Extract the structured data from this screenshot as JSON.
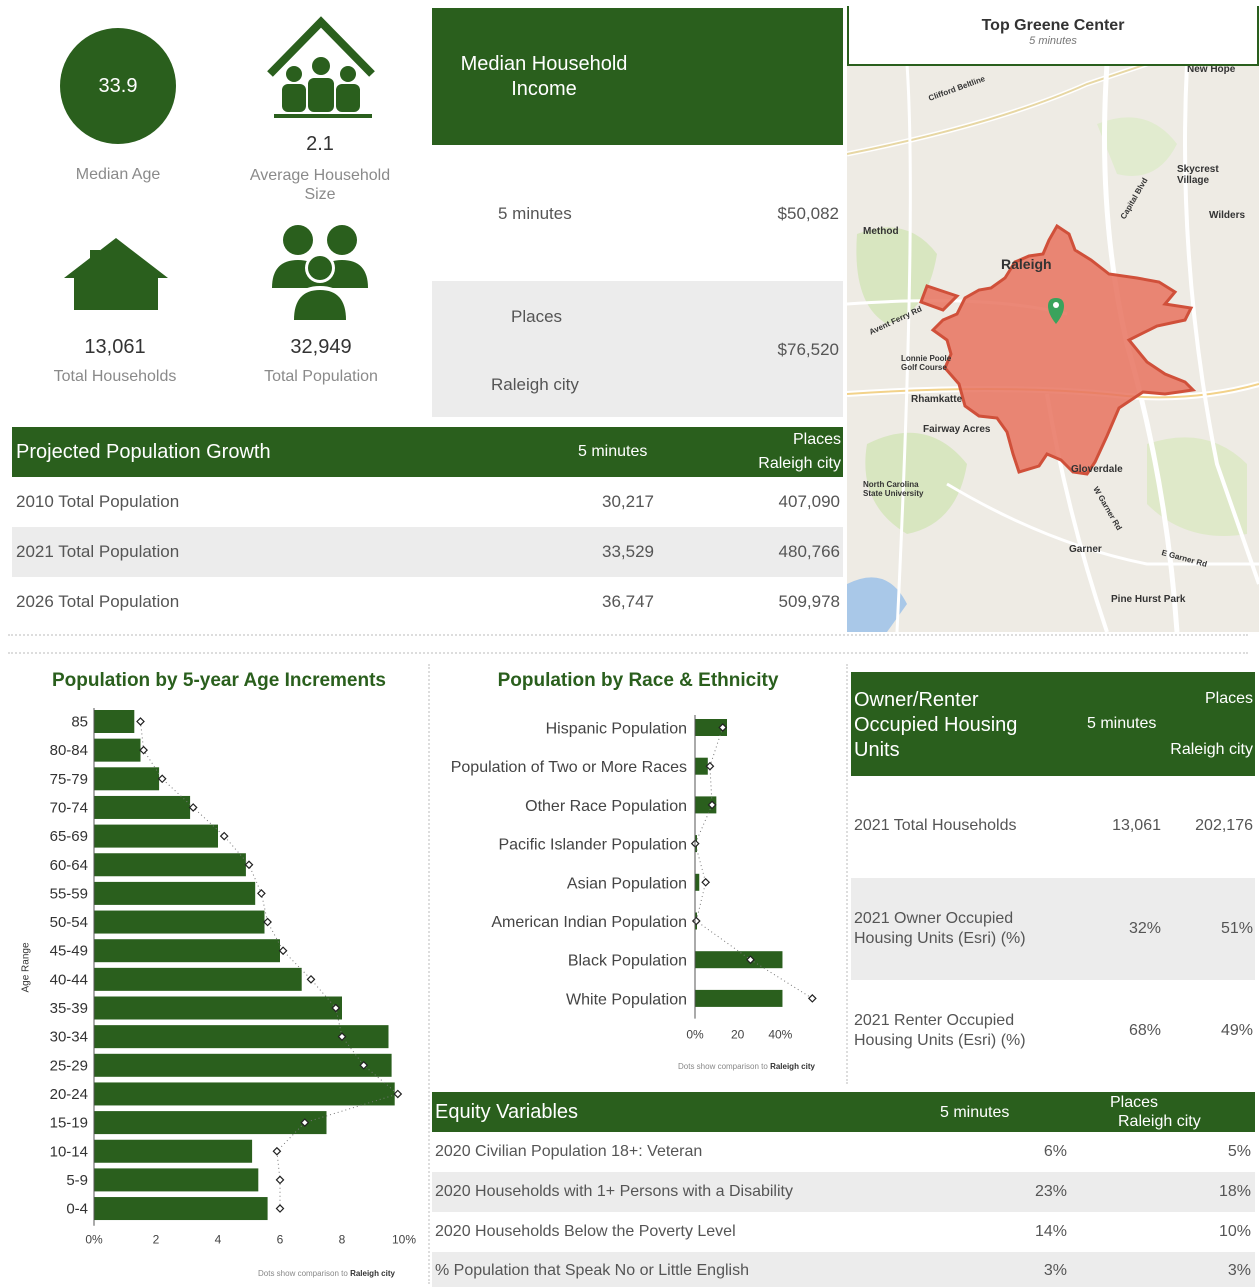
{
  "stats": {
    "median_age_value": "33.9",
    "median_age_label": "Median Age",
    "household_size_value": "2.1",
    "household_size_label": "Average Household Size",
    "total_households_value": "13,061",
    "total_households_label": "Total Households",
    "total_population_value": "32,949",
    "total_population_label": "Total Population"
  },
  "income": {
    "title": "Median Household Income",
    "row1_label": "5 minutes",
    "row1_value": "$50,082",
    "row2_label_a": "Places",
    "row2_label_b": "Raleigh city",
    "row2_value": "$76,520"
  },
  "map": {
    "title": "Top Greene Center",
    "subtitle": "5 minutes",
    "places": [
      "Raleigh",
      "Method",
      "Skycrest Village",
      "Wilders",
      "New Hope",
      "Rhamkatte",
      "Fairway Acres",
      "Lonnie Poole Golf Course",
      "North Carolina State University",
      "Gloverdale",
      "Garner",
      "Pine Hurst Park",
      "Clifford Beltline",
      "E Garner Rd",
      "W Garner Rd",
      "Avent Ferry Rd",
      "Capital Blvd"
    ]
  },
  "growth": {
    "title": "Projected Population Growth",
    "col1": "5 minutes",
    "col2_a": "Places",
    "col2_b": "Raleigh city",
    "rows": [
      {
        "label": "2010 Total Population",
        "v1": "30,217",
        "v2": "407,090"
      },
      {
        "label": "2021 Total Population",
        "v1": "33,529",
        "v2": "480,766"
      },
      {
        "label": "2026 Total Population",
        "v1": "36,747",
        "v2": "509,978"
      }
    ]
  },
  "age_chart": {
    "footnote_prefix": "Dots show comparison to",
    "footnote_place": "Raleigh city"
  },
  "race_chart": {
    "footnote_prefix": "Dots show comparison to",
    "footnote_place": "Raleigh city"
  },
  "chart_data": [
    {
      "type": "bar",
      "title": "Population by 5-year Age Increments",
      "ylabel": "Age Range",
      "xlabel": "",
      "xlim": [
        0,
        10
      ],
      "xticks": [
        "0%",
        "2",
        "4",
        "6",
        "8",
        "10%"
      ],
      "categories": [
        "85",
        "80-84",
        "75-79",
        "70-74",
        "65-69",
        "60-64",
        "55-59",
        "50-54",
        "45-49",
        "40-44",
        "35-39",
        "30-34",
        "25-29",
        "20-24",
        "15-19",
        "10-14",
        "5-9",
        "0-4"
      ],
      "series": [
        {
          "values": [
            1.3,
            1.5,
            2.1,
            3.1,
            4.0,
            4.9,
            5.2,
            5.5,
            6.0,
            6.7,
            8.0,
            9.5,
            9.6,
            9.7,
            7.5,
            5.1,
            5.3,
            5.6
          ]
        },
        {
          "values": [
            1.5,
            1.6,
            2.2,
            3.2,
            4.2,
            5.0,
            5.4,
            5.6,
            6.1,
            7.0,
            7.8,
            8.0,
            8.7,
            9.8,
            6.8,
            5.9,
            6.0,
            6.0
          ]
        }
      ]
    },
    {
      "type": "bar",
      "title": "Population by Race & Ethnicity",
      "xlim": [
        0,
        60
      ],
      "xticks": [
        "0%",
        "20",
        "40%"
      ],
      "categories": [
        "Hispanic Population",
        "Population of Two or More Races",
        "Other Race Population",
        "Pacific Islander Population",
        "Asian Population",
        "American Indian Population",
        "Black Population",
        "White Population"
      ],
      "series": [
        {
          "values": [
            15,
            6,
            10,
            0.2,
            2,
            0.5,
            41,
            41
          ]
        },
        {
          "values": [
            13,
            7,
            8,
            0.1,
            5,
            0.6,
            26,
            55
          ]
        }
      ]
    }
  ],
  "housing": {
    "title": "Owner/Renter Occupied Housing Units",
    "col1": "5 minutes",
    "col2_a": "Places",
    "col2_b": "Raleigh city",
    "rows": [
      {
        "label": "2021 Total Households",
        "v1": "13,061",
        "v2": "202,176"
      },
      {
        "label": "2021 Owner Occupied Housing Units (Esri) (%)",
        "v1": "32%",
        "v2": "51%"
      },
      {
        "label": "2021 Renter Occupied Housing Units (Esri) (%)",
        "v1": "68%",
        "v2": "49%"
      }
    ]
  },
  "equity": {
    "title": "Equity Variables",
    "col1": "5 minutes",
    "col2_a": "Places",
    "col2_b": "Raleigh city",
    "rows": [
      {
        "label": "2020 Civilian Population 18+: Veteran",
        "v1": "6%",
        "v2": "5%"
      },
      {
        "label": "2020 Households with 1+ Persons with a Disability",
        "v1": "23%",
        "v2": "18%"
      },
      {
        "label": "2020 Households Below the Poverty Level",
        "v1": "14%",
        "v2": "10%"
      },
      {
        "label": "% Population that Speak No or Little English",
        "v1": "3%",
        "v2": "3%"
      }
    ]
  },
  "colors": {
    "brand_green": "#2a5f1d",
    "row_gray": "#ececec",
    "map_area": "#e8735f"
  }
}
